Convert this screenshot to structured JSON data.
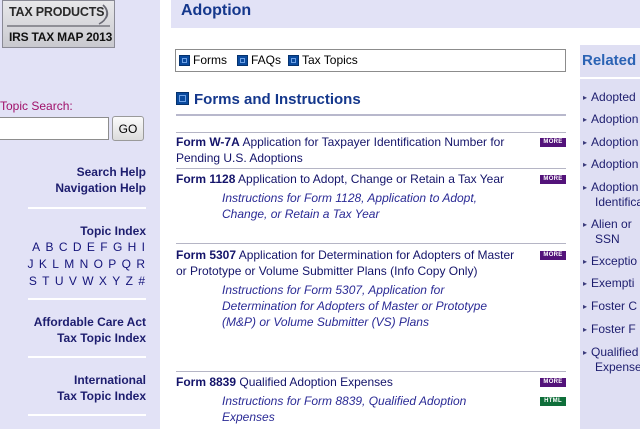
{
  "logo": {
    "line1": "TAX PRODUCTS",
    "line2": "IRS TAX MAP 2013"
  },
  "topic_search": {
    "label": "Topic Search:",
    "value": "",
    "go_label": "GO"
  },
  "sidebar": {
    "search_help": "Search Help",
    "navigation_help": "Navigation Help",
    "topic_index": "Topic Index",
    "letters_row1": [
      "A",
      "B",
      "C",
      "D",
      "E",
      "F",
      "G",
      "H",
      "I"
    ],
    "letters_row2": [
      "J",
      "K",
      "L",
      "M",
      "N",
      "O",
      "P",
      "Q",
      "R"
    ],
    "letters_row3": [
      "S",
      "T",
      "U",
      "V",
      "W",
      "X",
      "Y",
      "Z",
      "#"
    ],
    "aca_line1": "Affordable Care Act",
    "aca_line2": "Tax Topic Index",
    "intl_line1": "International",
    "intl_line2": "Tax Topic Index"
  },
  "header": {
    "title": "Adoption"
  },
  "tabs": {
    "forms": "Forms",
    "faqs": "FAQs",
    "tax_topics": "Tax Topics"
  },
  "section": {
    "title": "Forms and Instructions"
  },
  "forms": [
    {
      "number": "Form W-7A",
      "desc": "Application for Taxpayer Identification Number for Pending U.S. Adoptions",
      "badge": "MORE"
    },
    {
      "number": "Form 1128",
      "desc": "Application to Adopt, Change or Retain a Tax Year",
      "badge": "MORE",
      "instructions": "Instructions for Form 1128, Application to Adopt, Change, or Retain a Tax Year"
    },
    {
      "number": "Form 5307",
      "desc": "Application for Determination for Adopters of Master or Prototype or Volume Submitter Plans (Info Copy Only)",
      "badge": "MORE",
      "instructions": "Instructions for Form 5307, Application for Determination for Adopters of Master or Prototype (M&P) or Volume Submitter (VS) Plans"
    },
    {
      "number": "Form 8839",
      "desc": "Qualified Adoption Expenses",
      "badge": "MORE",
      "instructions": "Instructions for Form 8839, Qualified Adoption Expenses",
      "instructions_badge": "HTML"
    }
  ],
  "related": {
    "title": "Related",
    "items": [
      {
        "line1": "Adopted"
      },
      {
        "line1": "Adoption"
      },
      {
        "line1": "Adoption"
      },
      {
        "line1": "Adoption"
      },
      {
        "line1": "Adoption",
        "line2": "Identifica"
      },
      {
        "line1": "Alien or",
        "line2": "SSN"
      },
      {
        "line1": "Exceptio"
      },
      {
        "line1": "Exempti"
      },
      {
        "line1": "Foster C"
      },
      {
        "line1": "Foster F"
      },
      {
        "line1": "Qualified",
        "line2": "Expense"
      }
    ]
  }
}
